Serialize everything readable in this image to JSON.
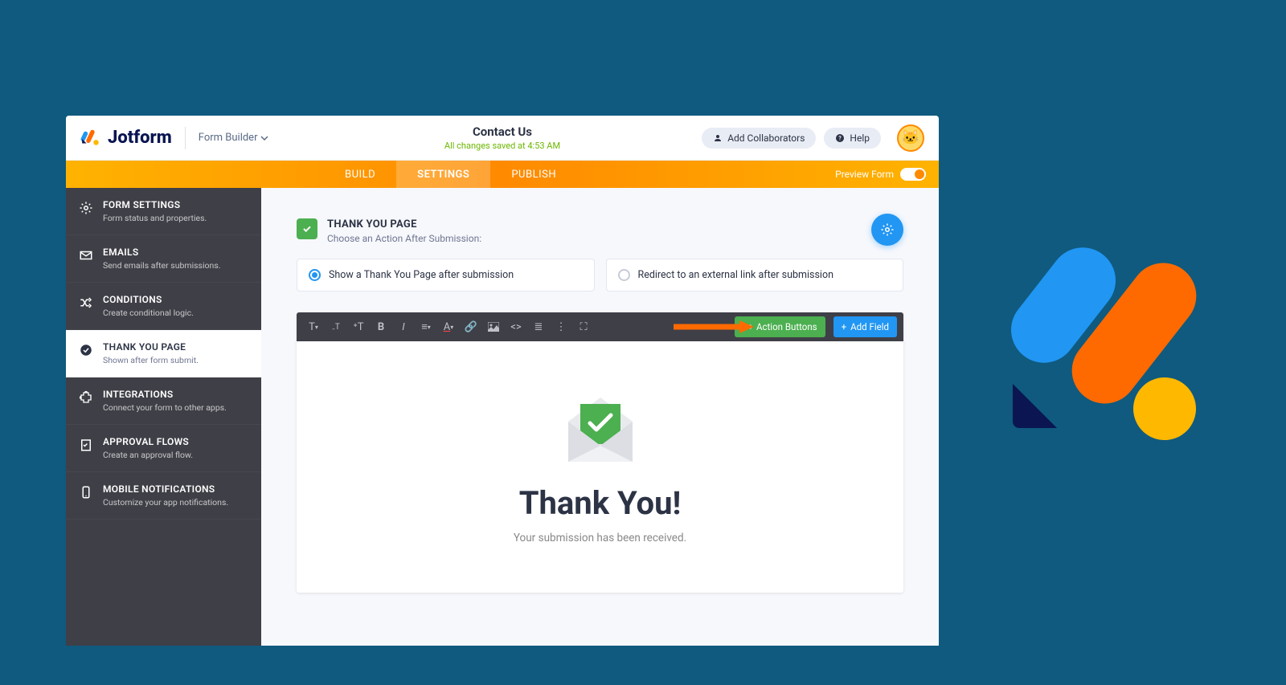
{
  "brand": "Jotform",
  "form_builder_label": "Form Builder",
  "topbar": {
    "title": "Contact Us",
    "saved_text": "All changes saved at 4:53 AM",
    "add_collaborators": "Add Collaborators",
    "help": "Help"
  },
  "ribbon": {
    "build": "BUILD",
    "settings": "SETTINGS",
    "publish": "PUBLISH",
    "preview": "Preview Form"
  },
  "sidebar": [
    {
      "title": "FORM SETTINGS",
      "sub": "Form status and properties."
    },
    {
      "title": "EMAILS",
      "sub": "Send emails after submissions."
    },
    {
      "title": "CONDITIONS",
      "sub": "Create conditional logic."
    },
    {
      "title": "THANK YOU PAGE",
      "sub": "Shown after form submit."
    },
    {
      "title": "INTEGRATIONS",
      "sub": "Connect your form to other apps."
    },
    {
      "title": "APPROVAL FLOWS",
      "sub": "Create an approval flow."
    },
    {
      "title": "MOBILE NOTIFICATIONS",
      "sub": "Customize your app notifications."
    }
  ],
  "section": {
    "title": "THANK YOU PAGE",
    "sub": "Choose an Action After Submission:"
  },
  "options": {
    "show_page": "Show a Thank You Page after submission",
    "redirect": "Redirect to an external link after submission"
  },
  "toolbar": {
    "action_buttons": "Action Buttons",
    "add_field": "Add Field"
  },
  "thankyou": {
    "title": "Thank You!",
    "sub": "Your submission has been received."
  }
}
